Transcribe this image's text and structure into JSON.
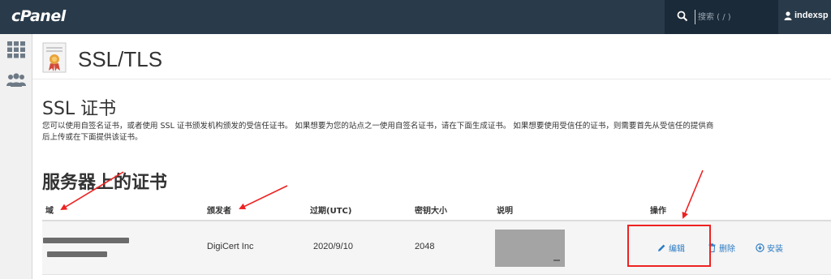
{
  "header": {
    "logo": "cPanel",
    "search_placeholder": "搜索 ( / )",
    "username": "indexsp"
  },
  "sidebar": {
    "items": [
      {
        "icon": "grid-icon"
      },
      {
        "icon": "users-icon"
      }
    ]
  },
  "page": {
    "title": "SSL/TLS",
    "icon": "certificate-icon"
  },
  "ssl_section": {
    "title": "SSL 证书",
    "description_line1": "您可以使用自签名证书，或者使用 SSL 证书颁发机构颁发的受信任证书。 如果想要为您的站点之一使用自签名证书，请在下面生成证书。 如果想要使用受信任的证书，则需要首先从受信任的提供商",
    "description_line2": "后上传或在下面提供该证书。"
  },
  "server_certs": {
    "title": "服务器上的证书",
    "columns": [
      "域",
      "颁发者",
      "过期(UTC)",
      "密钥大小",
      "说明",
      "操作"
    ],
    "rows": [
      {
        "domain": "",
        "issuer": "DigiCert Inc",
        "expiry": "2020/9/10",
        "key_size": "2048",
        "description": "",
        "actions": {
          "edit": "编辑",
          "delete": "删除",
          "install": "安装"
        }
      }
    ]
  },
  "colors": {
    "topbar": "#293a4a",
    "link": "#2b7bc4",
    "annotation": "#ee2222"
  }
}
